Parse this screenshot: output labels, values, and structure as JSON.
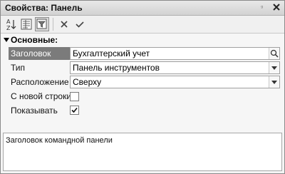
{
  "window": {
    "title": "Свойства: Панель",
    "pin_indicator": "ᵍ"
  },
  "toolbar": {
    "buttons": [
      {
        "name": "sort-alpha",
        "icon": "sort-az-icon"
      },
      {
        "name": "categories",
        "icon": "categories-icon"
      },
      {
        "name": "filter",
        "icon": "filter-icon",
        "active": true
      },
      {
        "name": "clear",
        "icon": "close-icon"
      },
      {
        "name": "apply",
        "icon": "check-icon"
      }
    ]
  },
  "section": {
    "title": "Основные:"
  },
  "properties": [
    {
      "label": "Заголовок",
      "value": "Бухгалтерский учет",
      "type": "text-search",
      "selected": true
    },
    {
      "label": "Тип",
      "value": "Панель инструментов",
      "type": "dropdown"
    },
    {
      "label": "Расположение",
      "value": "Сверху",
      "type": "dropdown"
    },
    {
      "label": "С новой строки",
      "type": "checkbox",
      "checked": false
    },
    {
      "label": "Показывать",
      "type": "checkbox",
      "checked": true
    }
  ],
  "description": {
    "text": "Заголовок командной панели"
  }
}
